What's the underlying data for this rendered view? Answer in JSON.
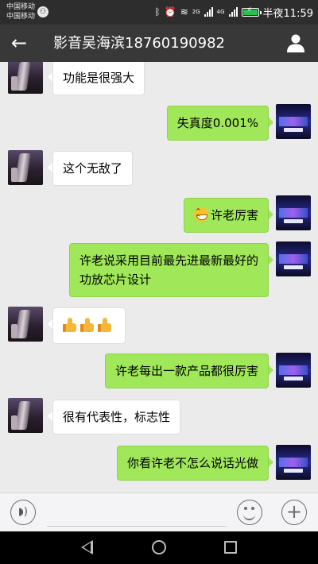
{
  "status_bar": {
    "carrier_line1": "中国移动",
    "carrier_line2": "中国移动",
    "network_label_1": "2G",
    "network_label_2": "4G",
    "time": "半夜11:59",
    "battery_color": "#25c24f",
    "icons": [
      "bluetooth-icon",
      "alarm-icon",
      "wifi-icon",
      "signal-icon",
      "battery-icon"
    ]
  },
  "nav_bar": {
    "title": "影音吴海滨18760190982",
    "back_icon": "arrow-left-icon",
    "profile_icon": "person-icon"
  },
  "messages": [
    {
      "side": "left",
      "text": "功能是很强大"
    },
    {
      "side": "right",
      "text": "失真度0.001%"
    },
    {
      "side": "left",
      "text": "这个无敌了"
    },
    {
      "side": "right",
      "text": "许老厉害",
      "emoji": "grin-emoji"
    },
    {
      "side": "right",
      "line1": "许老说采用目前最先进最新最好的",
      "line2": "功放芯片设计"
    },
    {
      "side": "left",
      "emoji": "thumbs-up-emoji",
      "emoji_count": 3
    },
    {
      "side": "right",
      "text": "许老每出一款产品都很厉害"
    },
    {
      "side": "left",
      "text": "很有代表性，标志性"
    },
    {
      "side": "right",
      "text": "你看许老不怎么说话光做"
    }
  ],
  "input_bar": {
    "voice_icon": "voice-icon",
    "input_value": "",
    "emoji_icon": "smiley-icon",
    "plus_icon": "plus-icon"
  },
  "colors": {
    "nav_bg": "#383838",
    "status_bg": "#2d2d2d",
    "chat_bg": "#ebebeb",
    "outgoing_bubble": "#a0e759",
    "incoming_bubble": "#ffffff"
  }
}
